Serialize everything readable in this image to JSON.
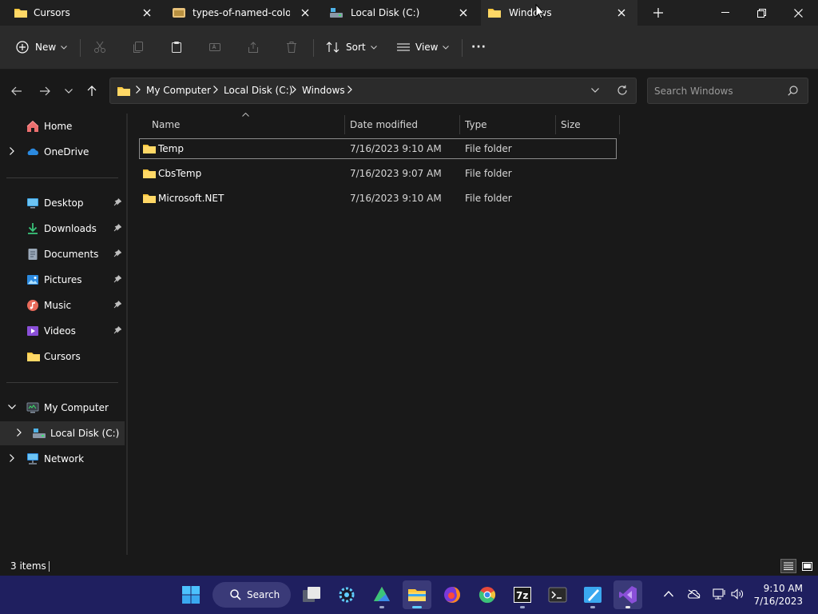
{
  "tabs": [
    {
      "title": "Cursors",
      "icon": "folder-icon"
    },
    {
      "title": "types-of-named-colors",
      "icon": "image-file-icon"
    },
    {
      "title": "Local Disk (C:)",
      "icon": "drive-icon"
    },
    {
      "title": "Windows",
      "icon": "folder-icon",
      "active": true
    }
  ],
  "toolbar": {
    "new_label": "New",
    "sort_label": "Sort",
    "view_label": "View",
    "more_label": "···"
  },
  "breadcrumb": [
    "My Computer",
    "Local Disk (C:)",
    "Windows"
  ],
  "search": {
    "placeholder": "Search Windows"
  },
  "sidebar": {
    "home": "Home",
    "onedrive": "OneDrive",
    "quick_access": [
      {
        "label": "Desktop",
        "icon": "desktop-icon"
      },
      {
        "label": "Downloads",
        "icon": "download-icon"
      },
      {
        "label": "Documents",
        "icon": "document-icon"
      },
      {
        "label": "Pictures",
        "icon": "pictures-icon"
      },
      {
        "label": "Music",
        "icon": "music-icon"
      },
      {
        "label": "Videos",
        "icon": "video-icon"
      },
      {
        "label": "Cursors",
        "icon": "folder-icon"
      }
    ],
    "my_computer": "My Computer",
    "local_disk": "Local Disk (C:)",
    "network": "Network"
  },
  "columns": {
    "name": "Name",
    "date": "Date modified",
    "type": "Type",
    "size": "Size"
  },
  "files": [
    {
      "name": "Temp",
      "date": "7/16/2023 9:10 AM",
      "type": "File folder",
      "size": ""
    },
    {
      "name": "CbsTemp",
      "date": "7/16/2023 9:07 AM",
      "type": "File folder",
      "size": ""
    },
    {
      "name": "Microsoft.NET",
      "date": "7/16/2023 9:10 AM",
      "type": "File folder",
      "size": ""
    }
  ],
  "status": {
    "items": "3 items"
  },
  "taskbar": {
    "search_label": "Search",
    "time": "9:10 AM",
    "date": "7/16/2023"
  },
  "colors": {
    "accent": "#60cdff",
    "folder": "#ffc83d",
    "taskbar": "#1f1f5f"
  }
}
